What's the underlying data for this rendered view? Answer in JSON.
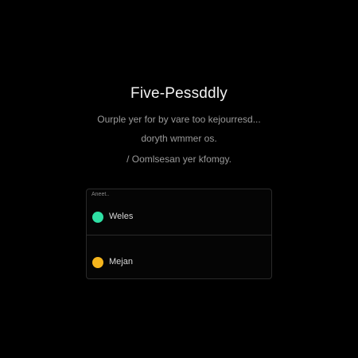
{
  "title": "Five-Pessddly",
  "description": [
    "Ourple yer for by vare too kejourresd...",
    "doryth wmmer os.",
    "/ Oomlsesan yer kfomgy."
  ],
  "card": {
    "label": "Aneet..",
    "options": [
      {
        "label": "Weles",
        "color": "#2ee0a4"
      },
      {
        "label": "Mejan",
        "color": "#f5b51d"
      }
    ]
  }
}
